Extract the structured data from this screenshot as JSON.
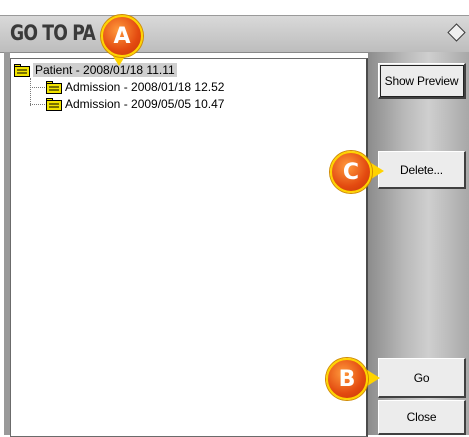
{
  "window": {
    "title": "GO TO PA",
    "menu_icon": "diamond-icon"
  },
  "tree": {
    "nodes": [
      {
        "label": "Patient - 2008/01/18 11.11",
        "icon": "folder-icon",
        "selected": true
      },
      {
        "label": "Admission - 2008/01/18 12.52",
        "icon": "folder-icon",
        "selected": false
      },
      {
        "label": "Admission - 2009/05/05 10.47",
        "icon": "folder-icon",
        "selected": false
      }
    ]
  },
  "buttons": {
    "show_preview": "Show Preview",
    "delete": "Delete...",
    "go": "Go",
    "close": "Close"
  },
  "callouts": {
    "a": "A",
    "b": "B",
    "c": "C"
  },
  "colors": {
    "callout_fill": "#e34a10",
    "callout_border": "#ffd400",
    "folder": "#f2e400",
    "selection": "#cfcfcf"
  }
}
